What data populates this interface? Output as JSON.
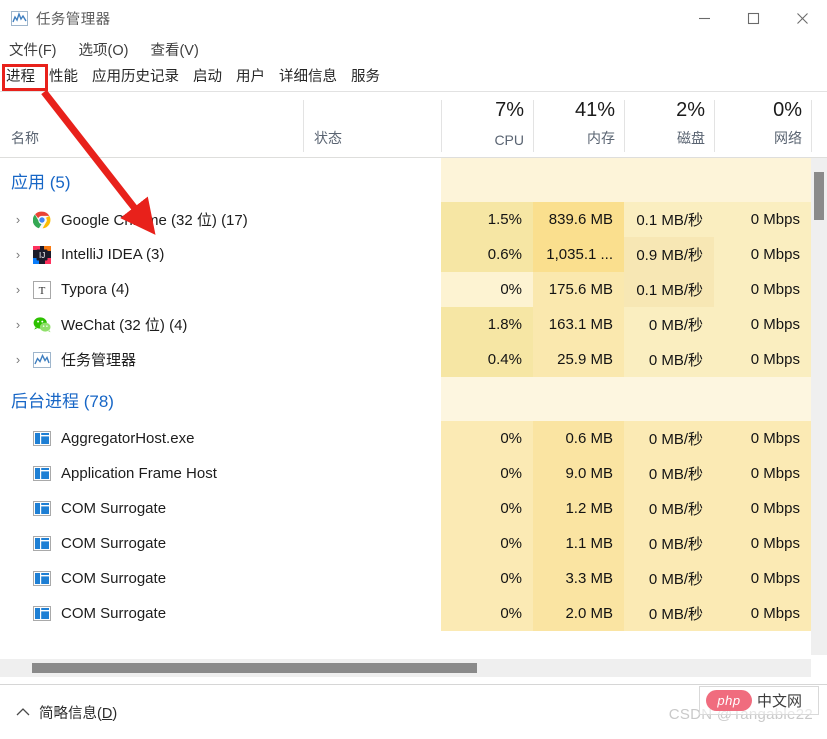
{
  "window": {
    "title": "任务管理器",
    "icon": "task-manager-icon",
    "controls": {
      "minimize": "—",
      "maximize": "▢",
      "close": "✕"
    }
  },
  "menubar": {
    "items": [
      {
        "label": "文件(F)"
      },
      {
        "label": "选项(O)"
      },
      {
        "label": "查看(V)"
      }
    ]
  },
  "tabs": {
    "active": "进程",
    "items": [
      {
        "label": "进程"
      },
      {
        "label": "性能"
      },
      {
        "label": "应用历史记录"
      },
      {
        "label": "启动"
      },
      {
        "label": "用户"
      },
      {
        "label": "详细信息"
      },
      {
        "label": "服务"
      }
    ]
  },
  "annotation": {
    "highlight_color": "#e8211b",
    "arrow_color": "#e8211b",
    "target_tab": "进程"
  },
  "columns": {
    "name": {
      "label": "名称",
      "sorted": "ascending"
    },
    "status": {
      "label": "状态"
    },
    "cpu": {
      "percent": "7%",
      "label": "CPU"
    },
    "memory": {
      "percent": "41%",
      "label": "内存"
    },
    "disk": {
      "percent": "2%",
      "label": "磁盘"
    },
    "network": {
      "percent": "0%",
      "label": "网络"
    }
  },
  "groups": [
    {
      "title": "应用 (5)",
      "rows": [
        {
          "name": "Google Chrome (32 位) (17)",
          "icon": "chrome-icon",
          "expandable": true,
          "cpu": "1.5%",
          "memory": "839.6 MB",
          "disk": "0.1 MB/秒",
          "network": "0 Mbps",
          "heat": {
            "cpu": "#f6e6a4",
            "memory": "#fadf8e",
            "disk": "#faeec0",
            "network": "#faeec0"
          }
        },
        {
          "name": "IntelliJ IDEA (3)",
          "icon": "intellij-icon",
          "expandable": true,
          "cpu": "0.6%",
          "memory": "1,035.1 ...",
          "disk": "0.9 MB/秒",
          "network": "0 Mbps",
          "heat": {
            "cpu": "#f6e6a4",
            "memory": "#fadf8e",
            "disk": "#f7e7b4",
            "network": "#faeec0"
          }
        },
        {
          "name": "Typora (4)",
          "icon": "typora-icon",
          "expandable": true,
          "cpu": "0%",
          "memory": "175.6 MB",
          "disk": "0.1 MB/秒",
          "network": "0 Mbps",
          "heat": {
            "cpu": "#fdf3d2",
            "memory": "#fae8ae",
            "disk": "#f7e7b4",
            "network": "#faeec0"
          }
        },
        {
          "name": "WeChat (32 位) (4)",
          "icon": "wechat-icon",
          "expandable": true,
          "cpu": "1.8%",
          "memory": "163.1 MB",
          "disk": "0 MB/秒",
          "network": "0 Mbps",
          "heat": {
            "cpu": "#f6e6a4",
            "memory": "#fae8ae",
            "disk": "#faeec0",
            "network": "#faeec0"
          }
        },
        {
          "name": "任务管理器",
          "icon": "task-manager-icon",
          "expandable": true,
          "cpu": "0.4%",
          "memory": "25.9 MB",
          "disk": "0 MB/秒",
          "network": "0 Mbps",
          "heat": {
            "cpu": "#f6e6a4",
            "memory": "#fae8ae",
            "disk": "#faeec0",
            "network": "#faeec0"
          }
        }
      ]
    },
    {
      "title": "后台进程 (78)",
      "rows": [
        {
          "name": "AggregatorHost.exe",
          "icon": "process-window-icon",
          "expandable": false,
          "cpu": "0%",
          "memory": "0.6 MB",
          "disk": "0 MB/秒",
          "network": "0 Mbps",
          "heat": {
            "cpu": "#fbeab4",
            "memory": "#fae4a2",
            "disk": "#fbeab4",
            "network": "#fbeab4"
          }
        },
        {
          "name": "Application Frame Host",
          "icon": "process-window-icon",
          "expandable": false,
          "cpu": "0%",
          "memory": "9.0 MB",
          "disk": "0 MB/秒",
          "network": "0 Mbps",
          "heat": {
            "cpu": "#fbeab4",
            "memory": "#fae4a2",
            "disk": "#fbeab4",
            "network": "#fbeab4"
          }
        },
        {
          "name": "COM Surrogate",
          "icon": "process-window-icon",
          "expandable": false,
          "cpu": "0%",
          "memory": "1.2 MB",
          "disk": "0 MB/秒",
          "network": "0 Mbps",
          "heat": {
            "cpu": "#fbeab4",
            "memory": "#fae4a2",
            "disk": "#fbeab4",
            "network": "#fbeab4"
          }
        },
        {
          "name": "COM Surrogate",
          "icon": "process-window-icon",
          "expandable": false,
          "cpu": "0%",
          "memory": "1.1 MB",
          "disk": "0 MB/秒",
          "network": "0 Mbps",
          "heat": {
            "cpu": "#fbeab4",
            "memory": "#fae4a2",
            "disk": "#fbeab4",
            "network": "#fbeab4"
          }
        },
        {
          "name": "COM Surrogate",
          "icon": "process-window-icon",
          "expandable": false,
          "cpu": "0%",
          "memory": "3.3 MB",
          "disk": "0 MB/秒",
          "network": "0 Mbps",
          "heat": {
            "cpu": "#fbeab4",
            "memory": "#fae4a2",
            "disk": "#fbeab4",
            "network": "#fbeab4"
          }
        },
        {
          "name": "COM Surrogate",
          "icon": "process-window-icon",
          "expandable": false,
          "cpu": "0%",
          "memory": "2.0 MB",
          "disk": "0 MB/秒",
          "network": "0 Mbps",
          "heat": {
            "cpu": "#fbeab4",
            "memory": "#fae4a2",
            "disk": "#fbeab4",
            "network": "#fbeab4"
          }
        }
      ],
      "header_heat": {
        "cpu": "#fdf6e0",
        "memory": "#fdf6e0",
        "disk": "#fdf6e0",
        "network": "#fdf6e0"
      }
    }
  ],
  "group_header_heat": {
    "cpu": "#fdf4d9",
    "memory": "#fdf4d9",
    "disk": "#fdf4d9",
    "network": "#fdf4d9"
  },
  "statusbar": {
    "caret": "chevron-up",
    "label_prefix": "简略信息(",
    "label_key": "D",
    "label_suffix": ")"
  },
  "watermarks": {
    "csdn": "CSDN @Tangable22",
    "php_badge": "php",
    "php_text": "中文网"
  }
}
